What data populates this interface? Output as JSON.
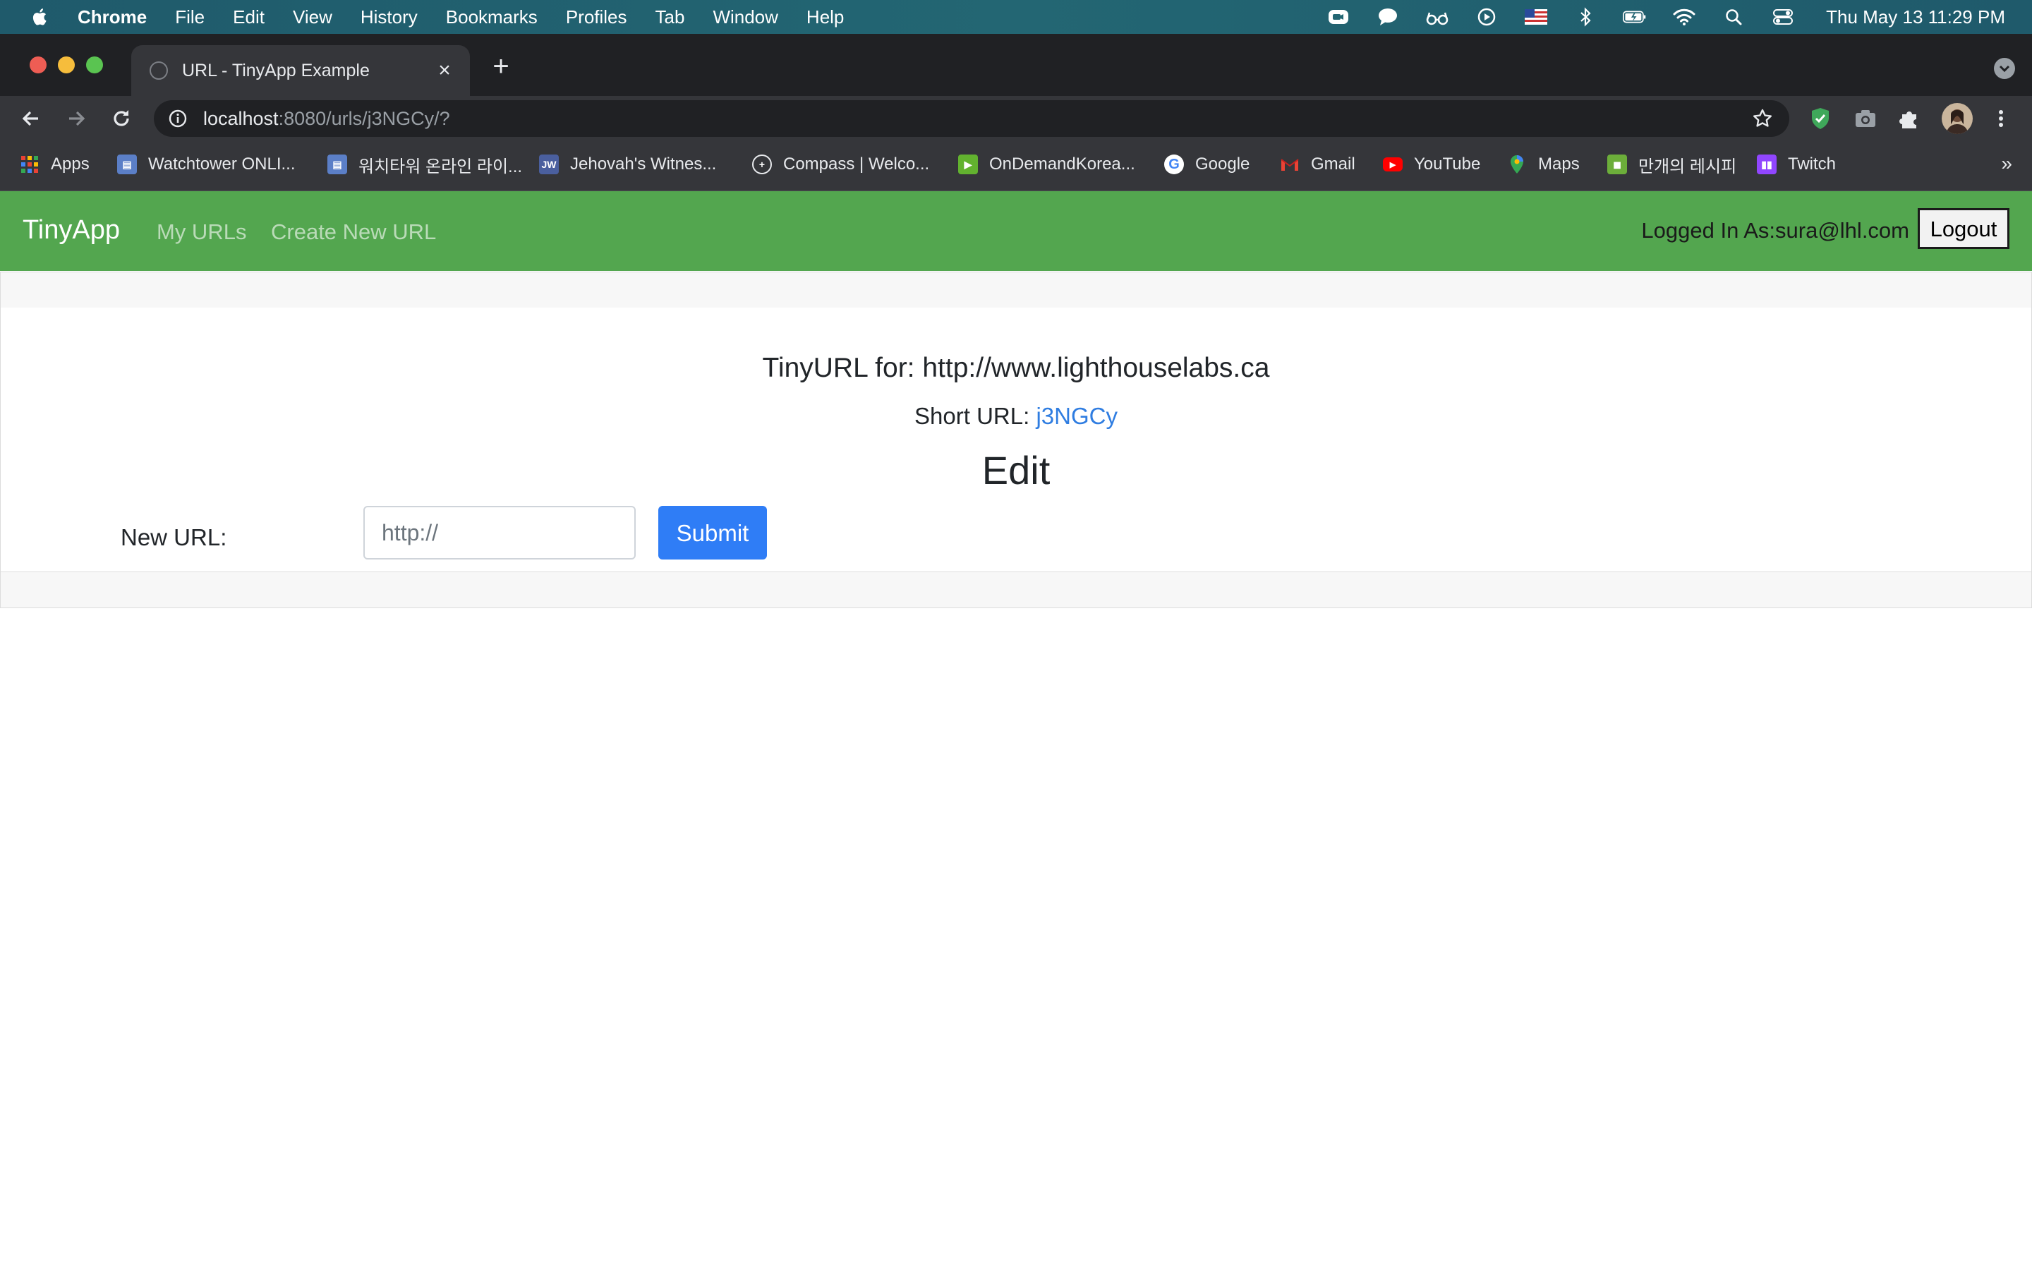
{
  "menubar": {
    "items": [
      "Chrome",
      "File",
      "Edit",
      "View",
      "History",
      "Bookmarks",
      "Profiles",
      "Tab",
      "Window",
      "Help"
    ],
    "clock": "Thu May 13  11:29 PM"
  },
  "browser": {
    "tab_title": "URL - TinyApp Example",
    "url_host": "localhost",
    "url_path": ":8080/urls/j3NGCy/?",
    "bookmarks": [
      {
        "label": "Apps",
        "icon": "apps-grid-icon"
      },
      {
        "label": "Watchtower ONLI...",
        "icon": "watchtower-icon"
      },
      {
        "label": "워치타워 온라인 라이...",
        "icon": "watchtower-icon"
      },
      {
        "label": "Jehovah's Witnes...",
        "icon": "jw-icon"
      },
      {
        "label": "Compass | Welco...",
        "icon": "compass-icon"
      },
      {
        "label": "OnDemandKorea...",
        "icon": "ondemandkorea-icon"
      },
      {
        "label": "Google",
        "icon": "google-icon"
      },
      {
        "label": "Gmail",
        "icon": "gmail-icon"
      },
      {
        "label": "YouTube",
        "icon": "youtube-icon"
      },
      {
        "label": "Maps",
        "icon": "maps-icon"
      },
      {
        "label": "만개의 레시피",
        "icon": "recipe-icon"
      },
      {
        "label": "Twitch",
        "icon": "twitch-icon"
      }
    ],
    "more": "»"
  },
  "navbar": {
    "brand": "TinyApp",
    "links": [
      "My URLs",
      "Create New URL"
    ],
    "logged_in": "Logged In As:sura@lhl.com",
    "logout": "Logout",
    "color": "#53a64f"
  },
  "main": {
    "title": "TinyURL for: http://www.lighthouselabs.ca",
    "short_label": "Short URL: ",
    "short_code": "j3NGCy",
    "edit_heading": "Edit",
    "new_url_label": "New URL:",
    "input_placeholder": "http://",
    "submit": "Submit"
  }
}
